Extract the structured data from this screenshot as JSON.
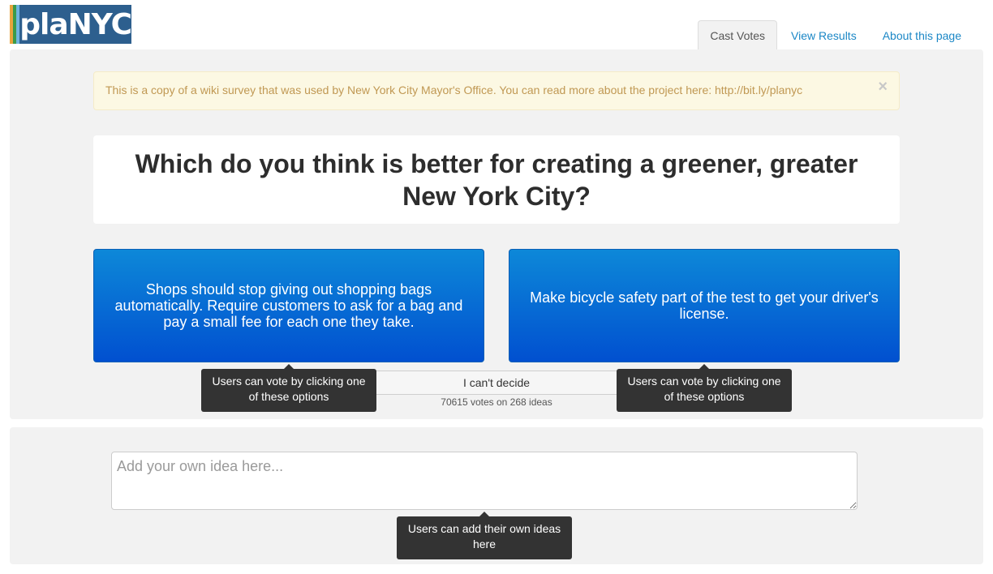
{
  "header": {
    "logo_text_plan": "plaN",
    "logo_text_nyc": "YC",
    "logo_stripe_colors": [
      "#e8a33d",
      "#3a9b4a",
      "#6fb4e0"
    ]
  },
  "nav": {
    "tabs": [
      {
        "label": "Cast Votes",
        "active": true
      },
      {
        "label": "View Results",
        "active": false
      },
      {
        "label": "About this page",
        "active": false
      }
    ]
  },
  "alert": {
    "message": "This is a copy of a wiki survey that was used by New York City Mayor's Office. You can read more about the project here: http://bit.ly/planyc",
    "close_symbol": "×"
  },
  "question": {
    "text": "Which do you think is better for creating a greener, greater New York City?"
  },
  "choices": {
    "left": "Shops should stop giving out shopping bags automatically. Require customers to ask for a bag and pay a small fee for each one they take.",
    "right": "Make bicycle safety part of the test to get your driver's license."
  },
  "skip": {
    "label": "I can't decide",
    "stats": "70615 votes on 268 ideas"
  },
  "tooltips": {
    "vote_left": "Users can vote by clicking one of these options",
    "vote_right": "Users can vote by clicking one of these options",
    "add_idea": "Users can add their own ideas here"
  },
  "idea": {
    "placeholder": "Add your own idea here..."
  },
  "colors": {
    "choice_gradient_top": "#0d88d8",
    "choice_gradient_bottom": "#0150d0",
    "link": "#1b87c6",
    "alert_text": "#c09853",
    "tooltip_bg": "#333333"
  }
}
